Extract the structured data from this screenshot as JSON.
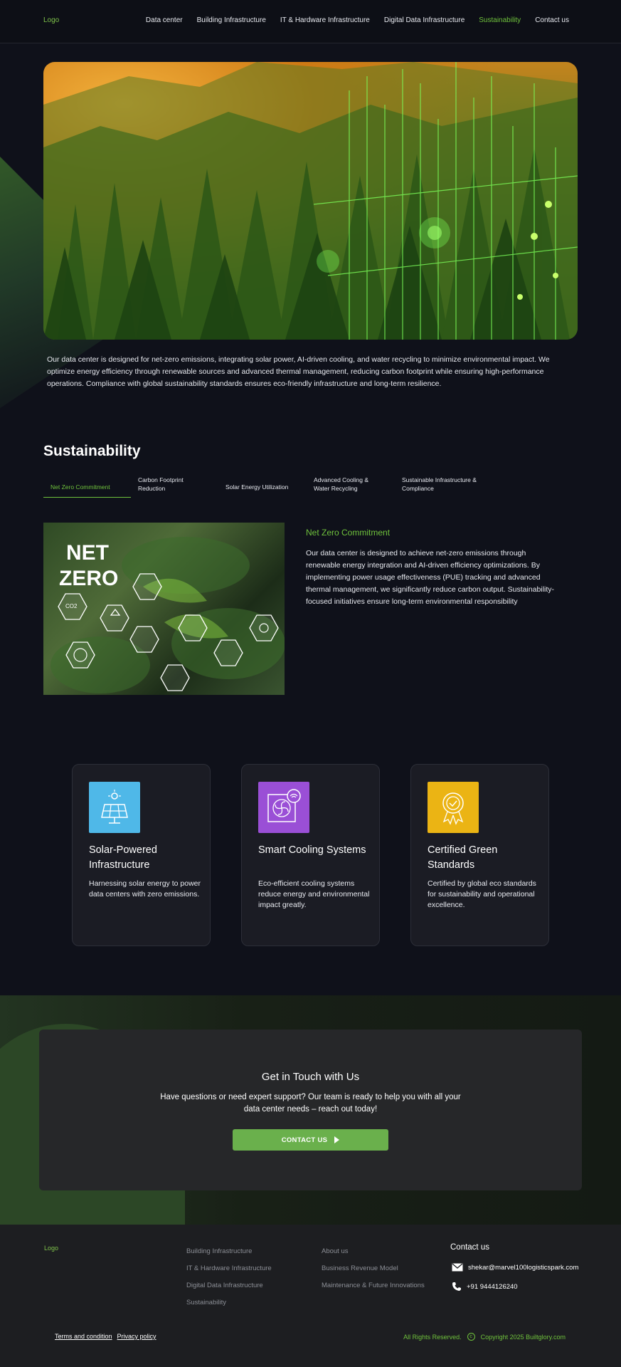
{
  "header": {
    "logo": "Logo",
    "nav": [
      {
        "label": "Data center"
      },
      {
        "label": "Building Infrastructure"
      },
      {
        "label": "IT & Hardware Infrastructure"
      },
      {
        "label": "Digital Data Infrastructure"
      },
      {
        "label": "Sustainability",
        "active": true
      },
      {
        "label": "Contact us"
      }
    ]
  },
  "hero": {
    "image_icon": "forest-with-green-data-lines-image",
    "text": "Our data center is designed for net-zero emissions, integrating solar power, AI-driven cooling, and water recycling to minimize environmental impact. We optimize energy efficiency through renewable sources and advanced thermal management, reducing carbon footprint while ensuring high-performance operations. Compliance with global sustainability standards ensures eco-friendly infrastructure and long-term resilience."
  },
  "section": {
    "title": "Sustainability",
    "tabs": [
      {
        "label": "Net Zero Commitment",
        "active": true
      },
      {
        "label": "Carbon Footprint Reduction"
      },
      {
        "label": "Solar Energy Utilization"
      },
      {
        "label": "Advanced Cooling & Water Recycling"
      },
      {
        "label": "Sustainable Infrastructure & Compliance"
      }
    ],
    "panel": {
      "image_text_1": "NET",
      "image_text_2": "ZERO",
      "image_co2": "CO2",
      "title": "Net Zero Commitment",
      "body": "Our data center is designed to achieve net-zero emissions through renewable energy integration and AI-driven efficiency optimizations. By implementing power usage effectiveness (PUE) tracking and advanced thermal management, we significantly reduce carbon output. Sustainability-focused initiatives ensure long-term environmental responsibility"
    }
  },
  "cards": [
    {
      "title": "Solar-Powered Infrastructure",
      "text": "Harnessing solar energy to power data centers with zero emissions.",
      "icon": "solar-panel-icon",
      "color": "#4fb8e8"
    },
    {
      "title": "Smart Cooling Systems",
      "text": " Eco-efficient cooling systems reduce energy and environmental impact greatly.",
      "icon": "fan-wifi-icon",
      "color": "#9a4fd6"
    },
    {
      "title": "Certified Green Standards",
      "text": " Certified by global eco standards for sustainability and operational excellence.",
      "icon": "certificate-badge-icon",
      "color": "#ebb414"
    }
  ],
  "cta": {
    "title": "Get in Touch with Us",
    "text": "Have questions or need expert support? Our team is ready to help you with all your data center needs – reach out today!",
    "button": "CONTACT US"
  },
  "footer": {
    "logo": "Logo",
    "col1": [
      "Building Infrastructure",
      "IT & Hardware Infrastructure",
      "Digital Data Infrastructure",
      "Sustainability"
    ],
    "col2": [
      "About us",
      "Business Revenue Model",
      "Maintenance & Future Innovations"
    ],
    "contact_title": "Contact us",
    "email": "shekar@marvel100logisticspark.com",
    "phone": "+91 9444126240",
    "terms": "Terms and condition",
    "privacy": "Privacy policy",
    "rights": "All Rights Reserved.",
    "copyright": "Copyright 2025 Builtglory.com"
  },
  "colors": {
    "accent": "#6fc23c",
    "background": "#0f111a",
    "button": "#6ab04c"
  }
}
